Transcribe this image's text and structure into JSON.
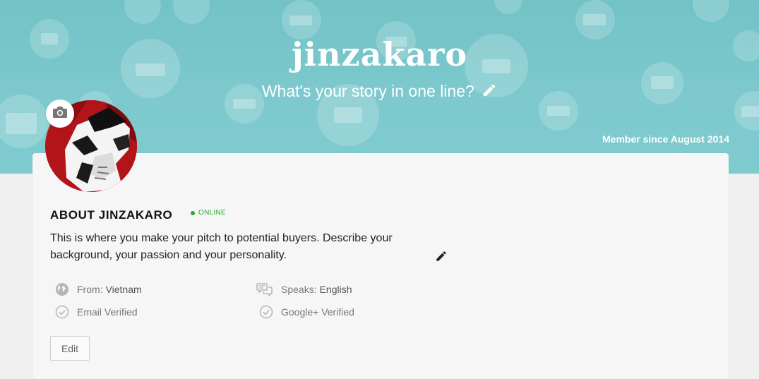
{
  "banner": {
    "username": "jinzakaro",
    "tagline": "What's your story in one line?",
    "member_since": "Member since August 2014"
  },
  "about": {
    "heading": "ABOUT JINZAKARO",
    "status": "ONLINE",
    "description": "This is where you make your pitch to potential buyers. Describe your background, your passion and your personality."
  },
  "facts": {
    "from_label": "From:",
    "from_value": "Vietnam",
    "speaks_label": "Speaks:",
    "speaks_value": "English",
    "email_verified": "Email Verified",
    "google_verified": "Google+ Verified"
  },
  "edit_label": "Edit",
  "colors": {
    "banner": "#7dc9cd",
    "online": "#2fa533",
    "card": "#f6f6f6"
  },
  "icons": [
    "camera-icon",
    "pencil-icon",
    "globe-icon",
    "speech-bubbles-icon",
    "check-circle-icon"
  ]
}
